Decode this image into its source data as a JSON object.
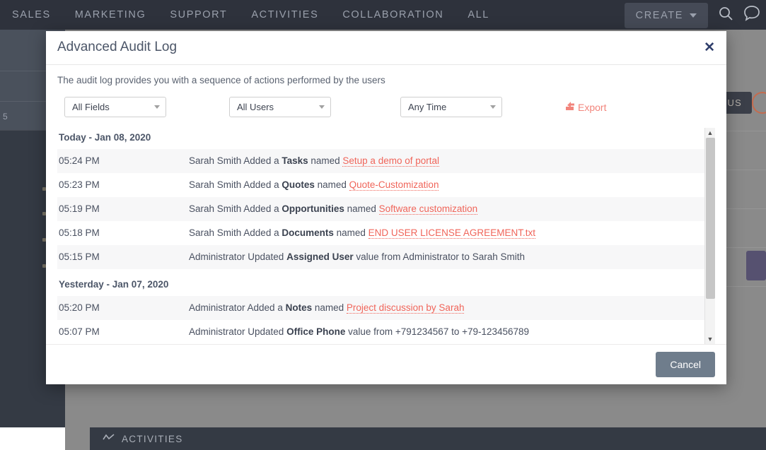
{
  "topnav": {
    "items": [
      {
        "label": "SALES"
      },
      {
        "label": "MARKETING"
      },
      {
        "label": "SUPPORT"
      },
      {
        "label": "ACTIVITIES"
      },
      {
        "label": "COLLABORATION"
      },
      {
        "label": "ALL"
      }
    ],
    "create_label": "CREATE",
    "search_icon": "search-icon",
    "chat_icon": "chat-bubble-icon"
  },
  "background": {
    "previous_label": "PREVIOUS",
    "activities_label": "ACTIVITIES",
    "activities_icon": "trend-line-icon",
    "left_badge": "5"
  },
  "modal": {
    "title": "Advanced Audit Log",
    "close_icon": "close-icon",
    "description": "The audit log provides you with a sequence of actions performed by the users",
    "filters": [
      {
        "name": "fields",
        "value": "All Fields"
      },
      {
        "name": "users",
        "value": "All Users"
      },
      {
        "name": "time",
        "value": "Any Time"
      }
    ],
    "export": {
      "label": "Export",
      "icon": "export-icon",
      "color": "#f2857c"
    },
    "groups": [
      {
        "header": "Today - Jan 08, 2020",
        "rows": [
          {
            "time": "05:24 PM",
            "prefix": "Sarah Smith Added a ",
            "bold": "Tasks",
            "mid": " named ",
            "link": "Setup a demo of portal",
            "suffix": ""
          },
          {
            "time": "05:23 PM",
            "prefix": "Sarah Smith Added a ",
            "bold": "Quotes",
            "mid": " named ",
            "link": "Quote-Customization",
            "suffix": ""
          },
          {
            "time": "05:19 PM",
            "prefix": "Sarah Smith Added a ",
            "bold": "Opportunities",
            "mid": " named ",
            "link": "Software customization",
            "suffix": ""
          },
          {
            "time": "05:18 PM",
            "prefix": "Sarah Smith Added a ",
            "bold": "Documents",
            "mid": " named ",
            "link": "END USER LICENSE AGREEMENT.txt",
            "suffix": ""
          },
          {
            "time": "05:15 PM",
            "prefix": "Administrator Updated ",
            "bold": "Assigned User",
            "mid": " value from Administrator to Sarah Smith",
            "link": "",
            "suffix": ""
          }
        ]
      },
      {
        "header": "Yesterday - Jan 07, 2020",
        "rows": [
          {
            "time": "05:20 PM",
            "prefix": "Administrator Added a ",
            "bold": "Notes",
            "mid": " named ",
            "link": "Project discussion by Sarah",
            "suffix": ""
          },
          {
            "time": "05:07 PM",
            "prefix": "Administrator Updated ",
            "bold": "Office Phone",
            "mid": " value from +791234567 to +79-123456789",
            "link": "",
            "suffix": ""
          }
        ]
      }
    ],
    "scrollbar": {
      "up_icon": "chevron-up-icon",
      "down_icon": "chevron-down-icon"
    },
    "cancel_label": "Cancel"
  },
  "colors": {
    "accent": "#f0655a",
    "title": "#4c5668",
    "nav_bg": "#2e323c",
    "cancel_bg": "#6f7d8c"
  }
}
